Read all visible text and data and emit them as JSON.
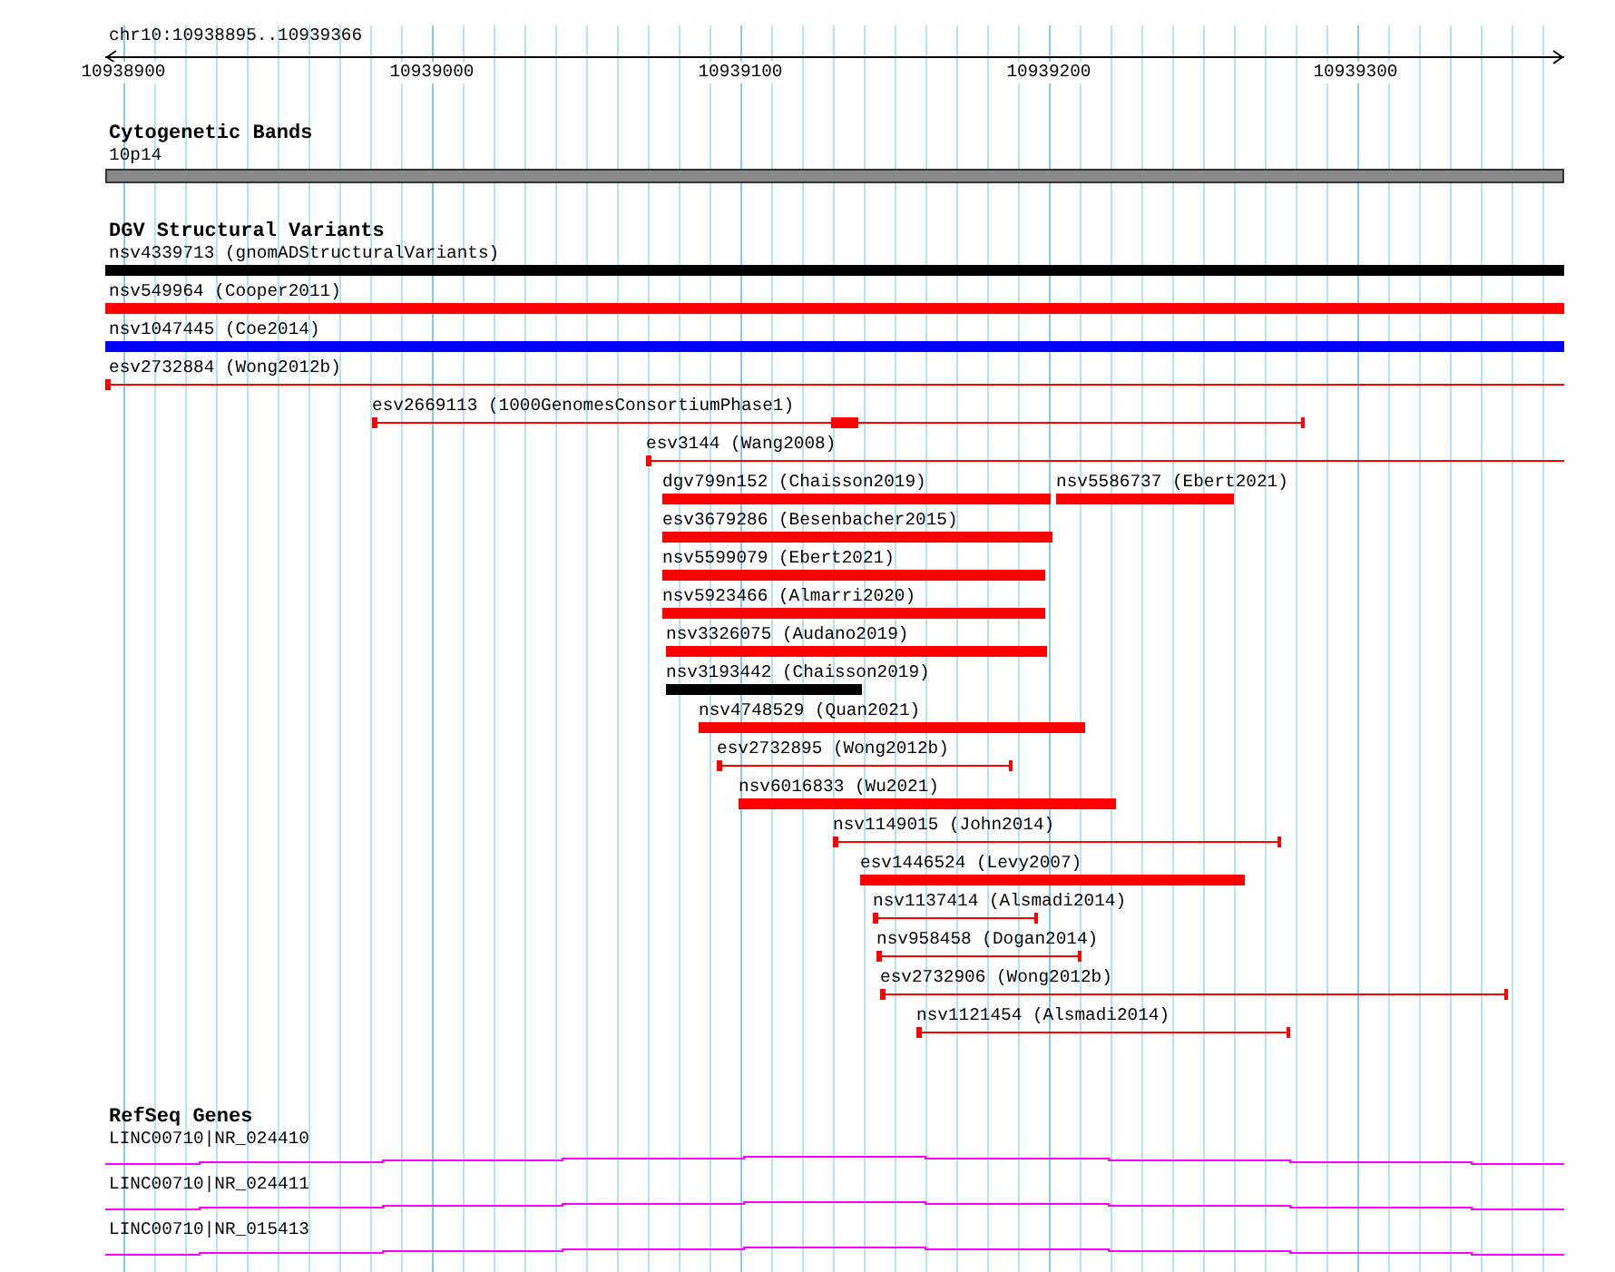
{
  "ruler": {
    "region": "chr10:10938895..10939366",
    "ticks": [
      "10938900",
      "10939000",
      "10939100",
      "10939200",
      "10939300"
    ]
  },
  "tracks": [
    {
      "title": "Cytogenetic Bands",
      "kind": "bands",
      "features": [
        {
          "label": "10p14"
        }
      ]
    },
    {
      "title": "DGV Structural Variants",
      "kind": "variants",
      "rows": [
        [
          {
            "label": "nsv4339713 (gnomADStructuralVariants)",
            "kind": "bar",
            "color": "#000000"
          }
        ],
        [
          {
            "label": "nsv549964 (Cooper2011)",
            "kind": "bar",
            "color": "#ff0000"
          }
        ],
        [
          {
            "label": "nsv1047445 (Coe2014)",
            "kind": "bar",
            "color": "#0000ff"
          }
        ],
        [
          {
            "label": "esv2732884 (Wong2012b)",
            "kind": "open",
            "color": "#ff0000"
          }
        ],
        [
          {
            "label": "esv2669113 (1000GenomesConsortiumPhase1)",
            "kind": "blocked",
            "color": "#ff0000"
          }
        ],
        [
          {
            "label": "esv3144 (Wang2008)",
            "kind": "open",
            "color": "#ff0000"
          }
        ],
        [
          {
            "label": "dgv799n152 (Chaisson2019)",
            "kind": "bar",
            "color": "#ff0000"
          },
          {
            "label": "nsv5586737 (Ebert2021)",
            "kind": "bar",
            "color": "#ff0000"
          }
        ],
        [
          {
            "label": "esv3679286 (Besenbacher2015)",
            "kind": "bar",
            "color": "#ff0000"
          }
        ],
        [
          {
            "label": "nsv5599079 (Ebert2021)",
            "kind": "bar",
            "color": "#ff0000"
          }
        ],
        [
          {
            "label": "nsv5923466 (Almarri2020)",
            "kind": "bar",
            "color": "#ff0000"
          }
        ],
        [
          {
            "label": "nsv3326075 (Audano2019)",
            "kind": "bar",
            "color": "#ff0000"
          }
        ],
        [
          {
            "label": "nsv3193442 (Chaisson2019)",
            "kind": "bar",
            "color": "#000000"
          }
        ],
        [
          {
            "label": "nsv4748529 (Quan2021)",
            "kind": "bar",
            "color": "#ff0000"
          }
        ],
        [
          {
            "label": "esv2732895 (Wong2012b)",
            "kind": "span",
            "color": "#ff0000"
          }
        ],
        [
          {
            "label": "nsv6016833 (Wu2021)",
            "kind": "bar",
            "color": "#ff0000"
          }
        ],
        [
          {
            "label": "nsv1149015 (John2014)",
            "kind": "span",
            "color": "#ff0000"
          }
        ],
        [
          {
            "label": "esv1446524 (Levy2007)",
            "kind": "bar",
            "color": "#ff0000"
          }
        ],
        [
          {
            "label": "nsv1137414 (Alsmadi2014)",
            "kind": "span",
            "color": "#ff0000"
          }
        ],
        [
          {
            "label": "nsv958458 (Dogan2014)",
            "kind": "span",
            "color": "#ff0000"
          }
        ],
        [
          {
            "label": "esv2732906 (Wong2012b)",
            "kind": "span",
            "color": "#ff0000"
          }
        ],
        [
          {
            "label": "nsv1121454 (Alsmadi2014)",
            "kind": "span",
            "color": "#ff0000"
          }
        ]
      ]
    },
    {
      "title": "RefSeq Genes",
      "kind": "genes",
      "features": [
        {
          "label": "LINC00710|NR_024410"
        },
        {
          "label": "LINC00710|NR_024411"
        },
        {
          "label": "LINC00710|NR_015413"
        }
      ]
    }
  ]
}
